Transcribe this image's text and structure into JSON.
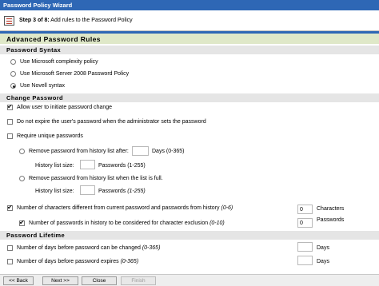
{
  "window": {
    "title": "Password Policy Wizard"
  },
  "step": {
    "bold": "Step 3 of 8:",
    "text": " Add rules to the Password Policy"
  },
  "page_title": "Advanced Password Rules",
  "syntax": {
    "heading": "Password Syntax",
    "options": [
      {
        "label": "Use Microsoft complexity policy",
        "selected": false
      },
      {
        "label": "Use Microsoft Server 2008 Password Policy",
        "selected": false
      },
      {
        "label": "Use Novell syntax",
        "selected": true
      }
    ]
  },
  "change": {
    "heading": "Change Password",
    "allow_change": {
      "label": "Allow user to initiate password change",
      "checked": true
    },
    "no_expire": {
      "label": "Do not expire the user's password when the administrator sets the password",
      "checked": false
    },
    "require_unique": {
      "label": "Require unique passwords",
      "checked": false
    },
    "remove_after": {
      "label": "Remove password from history list after:",
      "value": "",
      "unit": "Days",
      "range": "(0-365)",
      "selected": false
    },
    "history_size_1": {
      "label": "History list size:",
      "value": "",
      "unit": "Passwords",
      "range": "(1-255)"
    },
    "remove_full": {
      "label": "Remove password from history list when the list is full.",
      "selected": false
    },
    "history_size_2": {
      "label": "History list size:",
      "value": "",
      "unit": "Passwords",
      "range": "(1-255)"
    },
    "num_chars": {
      "label": "Number of characters different from current password and passwords from history",
      "range": "(0-6)",
      "checked": true,
      "value": "0",
      "unit": "Characters"
    },
    "num_history": {
      "label": "Number of passwords in history to be considered for character exclusion",
      "range": "(0-10)",
      "checked": true,
      "value": "0",
      "unit": "Passwords"
    }
  },
  "lifetime": {
    "heading": "Password Lifetime",
    "days_before_change": {
      "label": "Number of days before password can be changed",
      "range": "(0-365)",
      "checked": false,
      "value": "",
      "unit": "Days"
    },
    "days_before_expire": {
      "label": "Number of days before password expires",
      "range": "(0-365)",
      "checked": false,
      "value": "",
      "unit": "Days"
    }
  },
  "footer": {
    "back": "<< Back",
    "next": "Next >>",
    "close": "Close",
    "finish": "Finish"
  }
}
